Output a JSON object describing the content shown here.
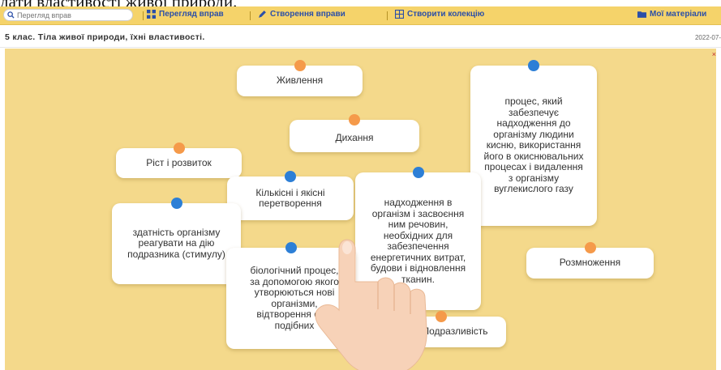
{
  "caption": "дати властивості живої природи.",
  "toolbar": {
    "search_placeholder": "Перегляд вправ",
    "view_exercises": "Перегляд вправ",
    "create_exercise": "Створення вправи",
    "create_collection": "Створити колекцію",
    "my_materials": "Мої матеріали"
  },
  "header": {
    "title": "5 клас. Тіла живої природи, їхні властивості.",
    "date": "2022-07-"
  },
  "board": {
    "close": "×",
    "cards": {
      "zhyvlennia": "Живлення",
      "dykhannia": "Дихання",
      "rist": "Ріст і розвиток",
      "kilkisni": "Кількісні і якісні перетворення",
      "zdatnist": "здатність організму реагувати на дію подразника (стимулу)",
      "protses_kysen": "процес, який забезпечує надходження до організму людини кисню, використання його в окиснювальних процесах і видалення з організму вуглекислого газу",
      "nadkhodzhennia": "надходження в організм і засвоєння ним речовин, необхідних для забезпечення енергетичних витрат, будови і відновлення тканин.",
      "biolohichnyi": "біологічний процес, за допомогою якого утворюються нові організми, відтворення собі подібних",
      "rozmnozhennia": "Розмноження",
      "podraznyvist": "Подразливість"
    }
  },
  "colors": {
    "toolbar_bg": "#f5d36a",
    "board_bg": "#f4d98b",
    "pin_orange": "#f59a4a",
    "pin_blue": "#2d7fd6",
    "link": "#2b4fa8"
  }
}
